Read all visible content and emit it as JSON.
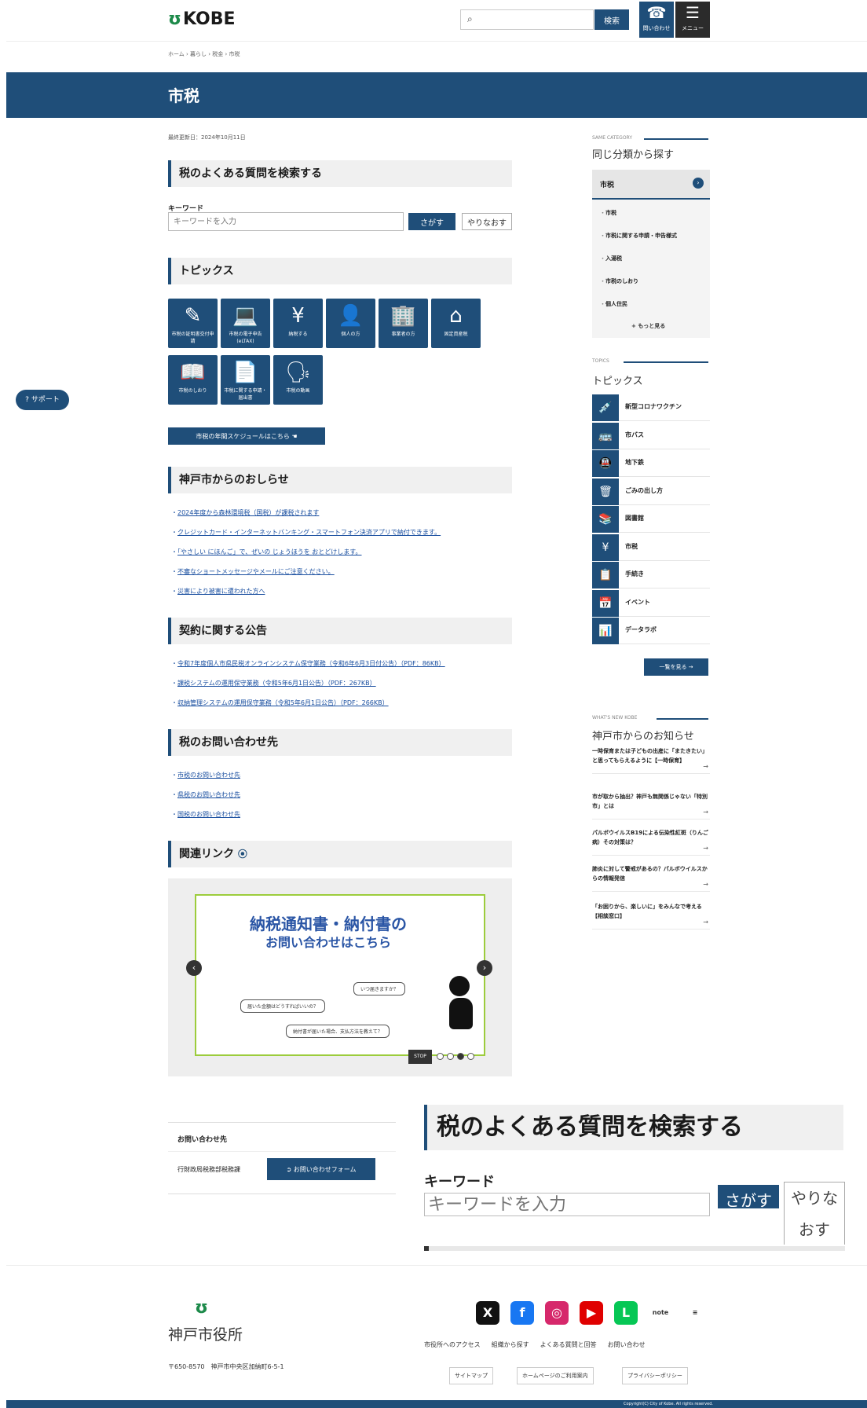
{
  "header": {
    "logo_text": "KOBE",
    "logo_mark": "ʊ",
    "search_placeholder": "",
    "search_button": "検索",
    "contact_label": "問い合わせ",
    "menu_label": "メニュー"
  },
  "breadcrumb": "ホーム › 暮らし › 税金 › 市税",
  "page": {
    "title": "市税",
    "updated": "最終更新日：2024年10月11日"
  },
  "faq": {
    "heading": "税のよくある質問を検索する",
    "keyword_label": "キーワード",
    "keyword_placeholder": "キーワードを入力",
    "search_button": "さがす",
    "reset_button": "やりなおす"
  },
  "topics": {
    "heading": "トピックス",
    "tiles": [
      {
        "icon": "edit-icon",
        "glyph": "✎",
        "label": "市税の証明書交付申請"
      },
      {
        "icon": "devices-icon",
        "glyph": "💻",
        "label": "市税の電子申告(eLTAX)"
      },
      {
        "icon": "yen-coin-icon",
        "glyph": "¥",
        "label": "納税する"
      },
      {
        "icon": "person-icon",
        "glyph": "👤",
        "label": "個人の方"
      },
      {
        "icon": "building-icon",
        "glyph": "🏢",
        "label": "事業者の方"
      },
      {
        "icon": "house-icon",
        "glyph": "⌂",
        "label": "固定資産税"
      },
      {
        "icon": "book-icon",
        "glyph": "📖",
        "label": "市税のしおり"
      },
      {
        "icon": "document-icon",
        "glyph": "📄",
        "label": "市税に関する申請・届出書"
      },
      {
        "icon": "presenter-icon",
        "glyph": "🗣",
        "label": "市税の動画"
      }
    ],
    "schedule_button": "市税の年間スケジュールはこちら"
  },
  "notices": {
    "heading": "神戸市からのおしらせ",
    "items": [
      "2024年度から森林環境税（国税）が課税されます",
      "クレジットカード・インターネットバンキング・スマートフォン決済アプリで納付できます。",
      "「やさしい にほんご」で、ぜいの じょうほうを おとどけします。",
      "不審なショートメッセージやメールにご注意ください。",
      "災害により被害に遭われた方へ"
    ]
  },
  "contracts": {
    "heading": "契約に関する公告",
    "items": [
      "令和7年度個人市県民税オンラインシステム保守業務（令和6年6月3日付公告）（PDF：86KB）",
      "課税システムの運用保守業務（令和5年6月1日公告）（PDF：267KB）",
      "収納管理システムの運用保守業務（令和5年6月1日公告）（PDF：266KB）"
    ]
  },
  "inquiry": {
    "heading": "税のお問い合わせ先",
    "items": [
      "市税のお問い合わせ先",
      "県税のお問い合わせ先",
      "国税のお問い合わせ先"
    ]
  },
  "related": {
    "heading": "関連リンク"
  },
  "banner": {
    "title_line1": "納税通知書・納付書の",
    "title_line2": "お問い合わせはこちら",
    "bubble1": "いつ届きますか？",
    "bubble2": "届いた金額はどうすればいいの？",
    "bubble3": "納付書が届いた場合、支払方法を教えて？",
    "stop_label": "STOP"
  },
  "contact": {
    "label": "お問い合わせ先",
    "dept": "行財政局税務部税務課",
    "form_button": "お問い合わせフォーム"
  },
  "zoom": {
    "heading": "税のよくある質問を検索する",
    "keyword_label": "キーワード",
    "keyword_placeholder": "キーワードを入力",
    "search_button": "さがす",
    "reset_button": "やりな\nおす"
  },
  "support": {
    "label": "サポート"
  },
  "sidebar": {
    "category_label": "SAME CATEGORY",
    "category_title": "同じ分類から探す",
    "box_head": "市税",
    "box_items": [
      "市税",
      "市税に関する申請・申告様式",
      "入湯税",
      "市税のしおり",
      "個人住民"
    ],
    "box_more": "もっと見る",
    "topics_label": "TOPICS",
    "topics_title": "トピックス",
    "topics": [
      {
        "icon": "syringe-icon",
        "glyph": "💉",
        "label": "新型コロナワクチン"
      },
      {
        "icon": "bus-icon",
        "glyph": "🚌",
        "label": "市バス"
      },
      {
        "icon": "subway-icon",
        "glyph": "🚇",
        "label": "地下鉄"
      },
      {
        "icon": "trash-icon",
        "glyph": "🗑",
        "label": "ごみの出し方"
      },
      {
        "icon": "library-icon",
        "glyph": "📚",
        "label": "図書館"
      },
      {
        "icon": "tax-icon",
        "glyph": "¥",
        "label": "市税"
      },
      {
        "icon": "procedure-icon",
        "glyph": "📋",
        "label": "手続き"
      },
      {
        "icon": "calendar-icon",
        "glyph": "📅",
        "label": "イベント"
      },
      {
        "icon": "data-icon",
        "glyph": "📊",
        "label": "データラボ"
      }
    ],
    "topics_all_button": "一覧を見る",
    "news_label": "WHAT'S NEW KOBE",
    "news_title": "神戸市からのお知らせ",
    "news": [
      "一時保育または子どもの出産に「またきたい」と思ってもらえるように【一時保育】",
      "市が取から抽出？神戸も無関係じゃない「特別市」とは",
      "パルボウイルスB19による伝染性紅斑（りんご病）その対策は？",
      "肺炎に対して警戒があるの？パルボウイルスからの情報発信",
      "「お困りから、楽しいに」をみんなで考える【相談窓口】"
    ]
  },
  "footer": {
    "logo_mark": "ʊ",
    "logo_name": "神戸市役所",
    "address": "〒650-8570　神戸市中央区加納町6-5-1",
    "socials": [
      {
        "icon": "x-icon",
        "glyph": "X",
        "color": "#111111"
      },
      {
        "icon": "facebook-icon",
        "glyph": "f",
        "color": "#1877f2"
      },
      {
        "icon": "instagram-icon",
        "glyph": "◎",
        "color": "#d6286b"
      },
      {
        "icon": "youtube-icon",
        "glyph": "▶",
        "color": "#e00000"
      },
      {
        "icon": "line-icon",
        "glyph": "L",
        "color": "#06c755"
      },
      {
        "icon": "note-icon",
        "glyph": "note",
        "color": "#ffffff"
      },
      {
        "icon": "other-sns-icon",
        "glyph": "≡",
        "color": "#ffffff"
      }
    ],
    "links": [
      "市役所へのアクセス",
      "組織から探す",
      "よくある質問と回答",
      "お問い合わせ"
    ],
    "buttons": [
      "サイトマップ",
      "ホームページのご利用案内",
      "プライバシーポリシー"
    ],
    "copyright": "Copyright(C) City of Kobe. All rights reserved."
  }
}
